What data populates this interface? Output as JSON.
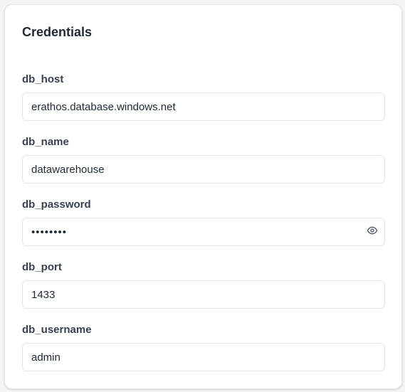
{
  "card": {
    "title": "Credentials"
  },
  "fields": [
    {
      "label": "db_host",
      "value": "erathos.database.windows.net",
      "type": "text"
    },
    {
      "label": "db_name",
      "value": "datawarehouse",
      "type": "text"
    },
    {
      "label": "db_password",
      "value": "********",
      "type": "password",
      "toggle_icon": "eye-icon"
    },
    {
      "label": "db_port",
      "value": "1433",
      "type": "text"
    },
    {
      "label": "db_username",
      "value": "admin",
      "type": "text"
    }
  ],
  "colors": {
    "card_background": "#ffffff",
    "page_background": "#f3f4f6",
    "text_primary": "#1f2937",
    "input_border": "#e2e4e8"
  }
}
